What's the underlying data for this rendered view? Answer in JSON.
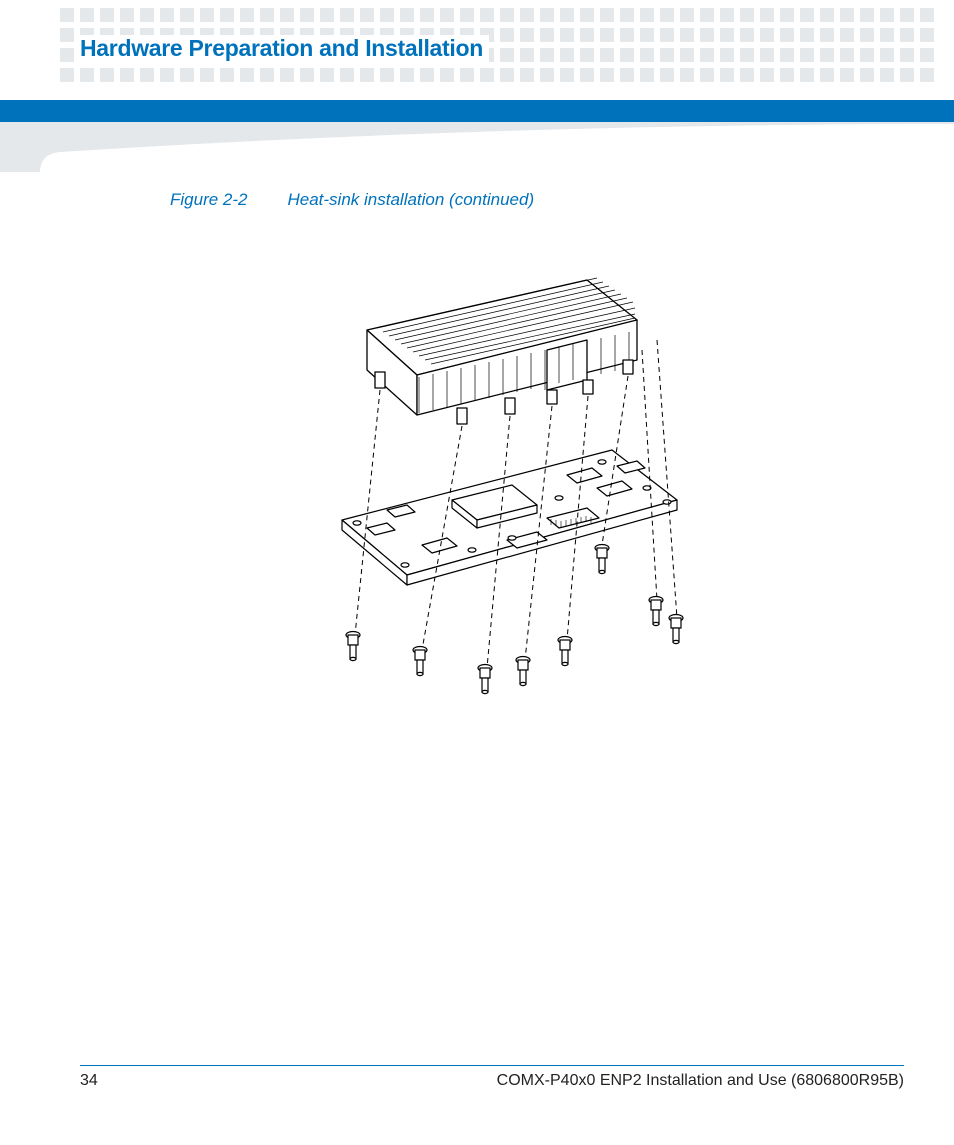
{
  "header": {
    "chapter_title": "Hardware Preparation and Installation"
  },
  "figure": {
    "label": "Figure 2-2",
    "title": "Heat-sink installation (continued)"
  },
  "footer": {
    "page_number": "34",
    "doc_title": "COMX-P40x0 ENP2 Installation and Use (6806800R95B)"
  }
}
